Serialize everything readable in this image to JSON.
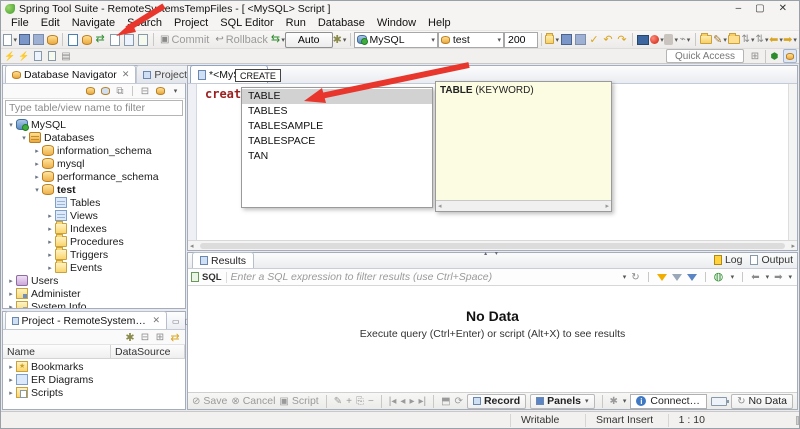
{
  "window": {
    "title": "Spring Tool Suite - RemoteSystemsTempFiles - [ <MySQL> Script ]",
    "controls": {
      "minimize": "–",
      "maximize": "▢",
      "close": "✕"
    }
  },
  "menubar": {
    "items": [
      "File",
      "Edit",
      "Navigate",
      "Search",
      "Project",
      "SQL Editor",
      "Run",
      "Database",
      "Window",
      "Help"
    ]
  },
  "toolbar": {
    "commit_label": "Commit",
    "rollback_label": "Rollback",
    "auto_label": "Auto",
    "connection_value": "MySQL",
    "database_value": "test",
    "fetch_size_value": "200",
    "quick_access_label": "Quick Access"
  },
  "navigator": {
    "tab_label": "Database Navigator",
    "tab2_label": "Projects",
    "filter_placeholder": "Type table/view name to filter",
    "tree": [
      {
        "l": "MySQL",
        "d": 0,
        "e": "open",
        "i": "conn",
        "b": false
      },
      {
        "l": "Databases",
        "d": 1,
        "e": "open",
        "i": "dbs",
        "b": false
      },
      {
        "l": "information_schema",
        "d": 2,
        "e": "closed",
        "i": "db",
        "b": false
      },
      {
        "l": "mysql",
        "d": 2,
        "e": "closed",
        "i": "db",
        "b": false
      },
      {
        "l": "performance_schema",
        "d": 2,
        "e": "closed",
        "i": "db",
        "b": false
      },
      {
        "l": "test",
        "d": 2,
        "e": "open",
        "i": "db",
        "b": true
      },
      {
        "l": "Tables",
        "d": 3,
        "e": "none",
        "i": "tblf",
        "b": false
      },
      {
        "l": "Views",
        "d": 3,
        "e": "closed",
        "i": "tblf",
        "b": false
      },
      {
        "l": "Indexes",
        "d": 3,
        "e": "closed",
        "i": "folder",
        "b": false
      },
      {
        "l": "Procedures",
        "d": 3,
        "e": "closed",
        "i": "folder",
        "b": false
      },
      {
        "l": "Triggers",
        "d": 3,
        "e": "closed",
        "i": "folder",
        "b": false
      },
      {
        "l": "Events",
        "d": 3,
        "e": "closed",
        "i": "folder",
        "b": false
      },
      {
        "l": "Users",
        "d": 0,
        "e": "closed",
        "i": "users",
        "b": false
      },
      {
        "l": "Administer",
        "d": 0,
        "e": "closed",
        "i": "adm",
        "b": false
      },
      {
        "l": "System Info",
        "d": 0,
        "e": "closed",
        "i": "sys",
        "b": false
      }
    ]
  },
  "editor": {
    "tab_label": "*<MySQL>",
    "hint_label": "CREATE",
    "code": "create ta"
  },
  "completion": {
    "items": [
      "TABLE",
      "TABLES",
      "TABLESAMPLE",
      "TABLESPACE",
      "TAN"
    ],
    "selected_index": 0,
    "info_bold": "TABLE",
    "info_rest": " (KEYWORD)"
  },
  "results": {
    "tab_label": "Results",
    "log_label": "Log",
    "output_label": "Output",
    "sql_label": "SQL",
    "filter_placeholder": "Enter a SQL expression to filter results (use Ctrl+Space)",
    "no_data_title": "No Data",
    "no_data_hint": "Execute query (Ctrl+Enter) or script (Alt+X) to see results",
    "save_label": "Save",
    "cancel_label": "Cancel",
    "script_label": "Script",
    "record_label": "Record",
    "panels_label": "Panels",
    "connected_label": "Connected to \"MySQL\"",
    "no_data_button_label": "No Data"
  },
  "project_panel": {
    "tab_label": "Project - RemoteSystemsTempFiles",
    "columns": {
      "name": "Name",
      "datasource": "DataSource"
    },
    "tree": [
      {
        "l": "Bookmarks",
        "d": 0,
        "e": "closed",
        "i": "bookmarks",
        "b": false
      },
      {
        "l": "ER Diagrams",
        "d": 0,
        "e": "closed",
        "i": "erd",
        "b": false
      },
      {
        "l": "Scripts",
        "d": 0,
        "e": "closed",
        "i": "scripts",
        "b": false
      }
    ]
  },
  "statusbar": {
    "writable": "Writable",
    "smart_insert": "Smart Insert",
    "position": "1 : 10"
  },
  "colors": {
    "accent_red_arrow": "#e8362d",
    "keyword_red": "#9c1f1f",
    "info_yellow": "#fcfce2"
  },
  "icons": {
    "caret_down": "▾",
    "expander_open": "▾",
    "expander_closed": "▸",
    "refresh": "↻",
    "pencil": "✎",
    "plus": "+",
    "minus": "−",
    "first": "|◂",
    "prev": "◂",
    "next": "▸",
    "last": "▸|",
    "save_disabled": "⊘",
    "cancel_disabled": "⊗",
    "gear": "✱",
    "up": "▴",
    "down": "▾",
    "left": "◂",
    "right": "▸",
    "grid": "▦",
    "close_small": "×"
  }
}
